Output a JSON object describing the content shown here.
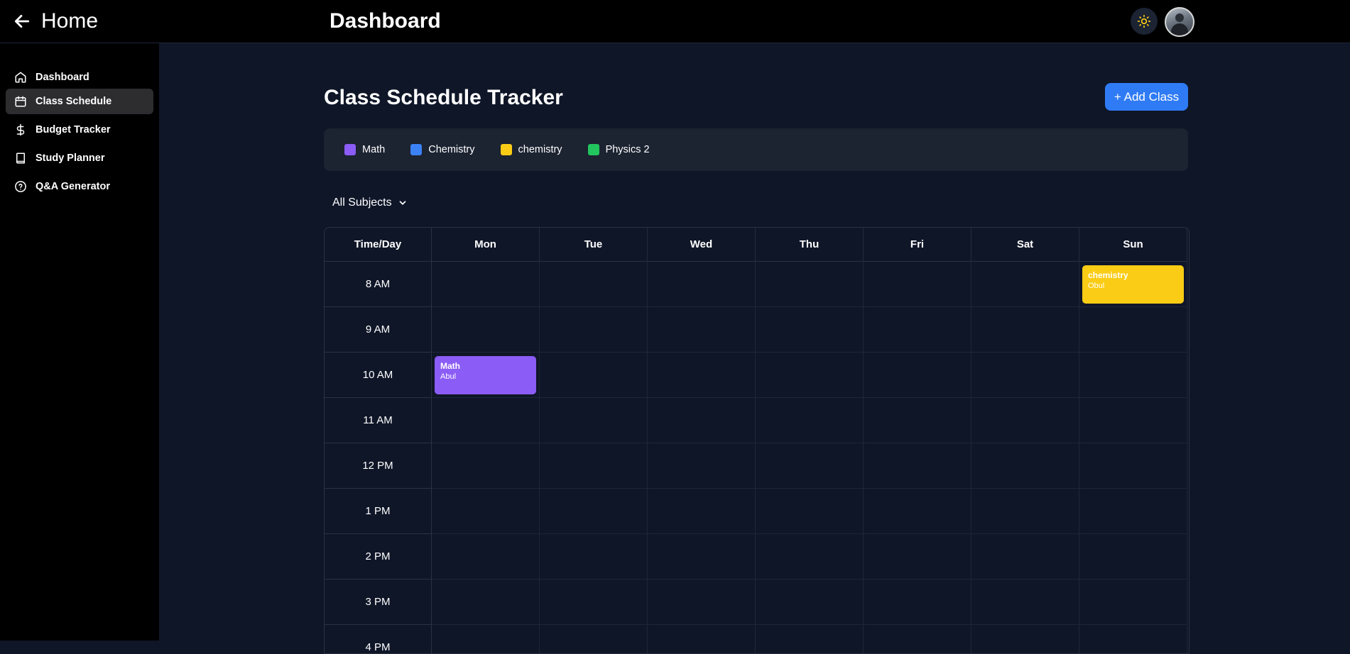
{
  "topbar": {
    "home_label": "Home",
    "page_heading": "Dashboard"
  },
  "sidebar": {
    "items": [
      {
        "label": "Dashboard",
        "icon": "home-icon"
      },
      {
        "label": "Class Schedule",
        "icon": "calendar-icon",
        "active": true
      },
      {
        "label": "Budget Tracker",
        "icon": "dollar-icon"
      },
      {
        "label": "Study Planner",
        "icon": "book-icon"
      },
      {
        "label": "Q&A Generator",
        "icon": "help-circle-icon"
      }
    ]
  },
  "main": {
    "title": "Class Schedule Tracker",
    "add_button": "+ Add Class",
    "legend": [
      {
        "label": "Math",
        "color": "#8b5cf6"
      },
      {
        "label": "Chemistry",
        "color": "#3b82f6"
      },
      {
        "label": "chemistry",
        "color": "#facc15"
      },
      {
        "label": "Physics 2",
        "color": "#22c55e"
      }
    ],
    "filter_label": "All Subjects"
  },
  "schedule": {
    "header_first": "Time/Day",
    "days": [
      "Mon",
      "Tue",
      "Wed",
      "Thu",
      "Fri",
      "Sat",
      "Sun"
    ],
    "times": [
      "8 AM",
      "9 AM",
      "10 AM",
      "11 AM",
      "12 PM",
      "1 PM",
      "2 PM",
      "3 PM",
      "4 PM"
    ],
    "events": [
      {
        "title": "chemistry",
        "subtitle": "Obul",
        "day": "Sun",
        "time": "8 AM",
        "color": "#facc15"
      },
      {
        "title": "Math",
        "subtitle": "Abul",
        "day": "Mon",
        "time": "10 AM",
        "color": "#8b5cf6"
      }
    ]
  },
  "colors": {
    "accent": "#2f7bf5",
    "background": "#0f1628",
    "sidebar": "#000000",
    "theme_icon": "#facc15"
  }
}
